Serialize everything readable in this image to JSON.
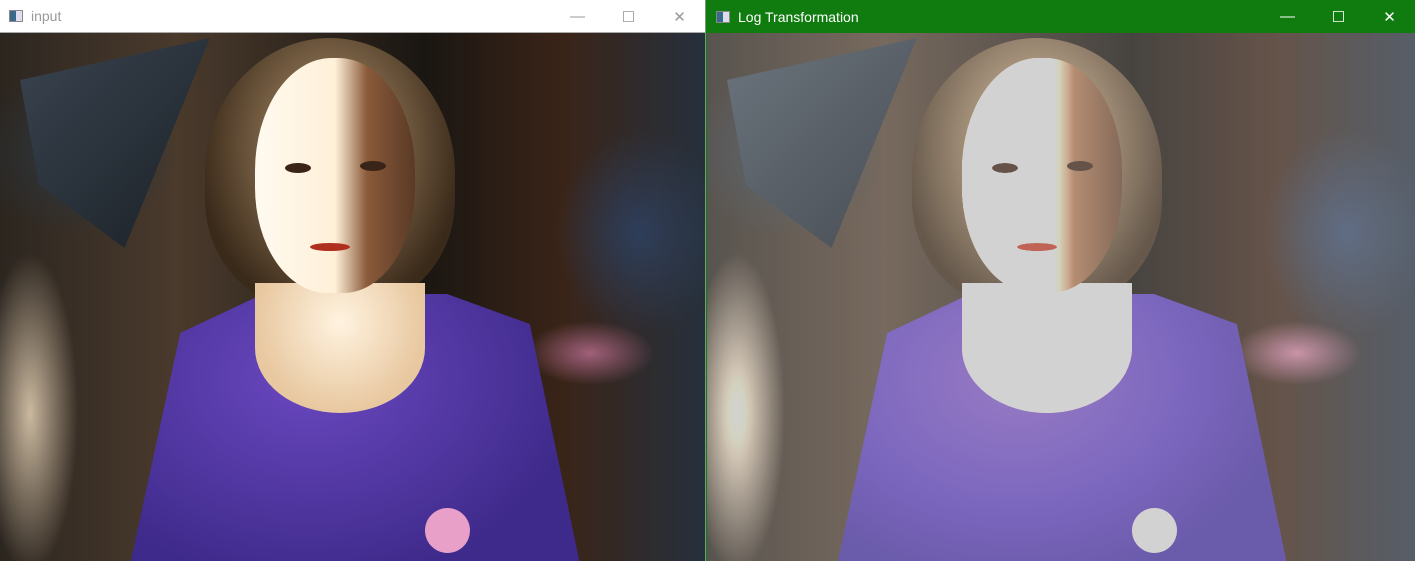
{
  "windows": [
    {
      "title": "input",
      "controls": {
        "minimize": "—",
        "maximize": "☐",
        "close": "✕"
      }
    },
    {
      "title": "Log Transformation",
      "controls": {
        "minimize": "—",
        "maximize": "☐",
        "close": "✕"
      }
    }
  ],
  "colors": {
    "active_titlebar": "#107c10",
    "inactive_titlebar": "#ffffff"
  }
}
